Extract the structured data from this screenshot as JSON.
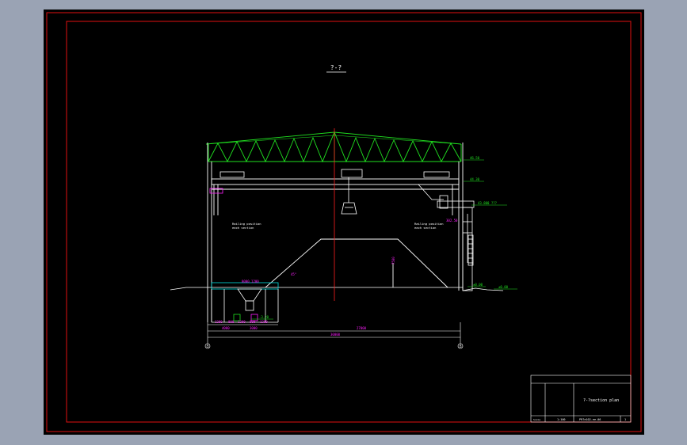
{
  "colors": {
    "background": "#9aa3b4",
    "sheet": "#000000",
    "border": "#e01010",
    "structure": "#ffffff",
    "truss": "#20e020",
    "annotation": "#ff20ff",
    "centerline": "#ff2020",
    "dimension": "#ff20ff"
  },
  "section_title": "?-?",
  "elevations": {
    "roof_top": "46.50",
    "rail_top": "44.30",
    "crane_beam": "43.800 ???",
    "ground_right": "±0.00",
    "ground_far_right": "±0.00",
    "pit_floor": "-3.20",
    "rail_label": "302.50"
  },
  "labels": {
    "left_note_line1": "Railing position",
    "left_note_line2": "each section",
    "right_note_line1": "Railing position",
    "right_note_line2": "each section",
    "pit_label": "8000 1200",
    "stockpile_height": "7500",
    "slope_label": "45°"
  },
  "dimensions": {
    "seg1": "1200",
    "seg2": "800",
    "seg3": "1200",
    "seg4": "800",
    "seg5": "1200",
    "sub1": "4000",
    "sub2": "3000",
    "span_inner": "27000",
    "span_total": "30000"
  },
  "axes": {
    "left": "①",
    "right": "②"
  },
  "title_block": {
    "drawing_name": "?-?section plan",
    "scale_label": "Scale",
    "scale": "1:100",
    "drawing_no": "PR7e102-ee-06",
    "sheet_no": "1"
  }
}
